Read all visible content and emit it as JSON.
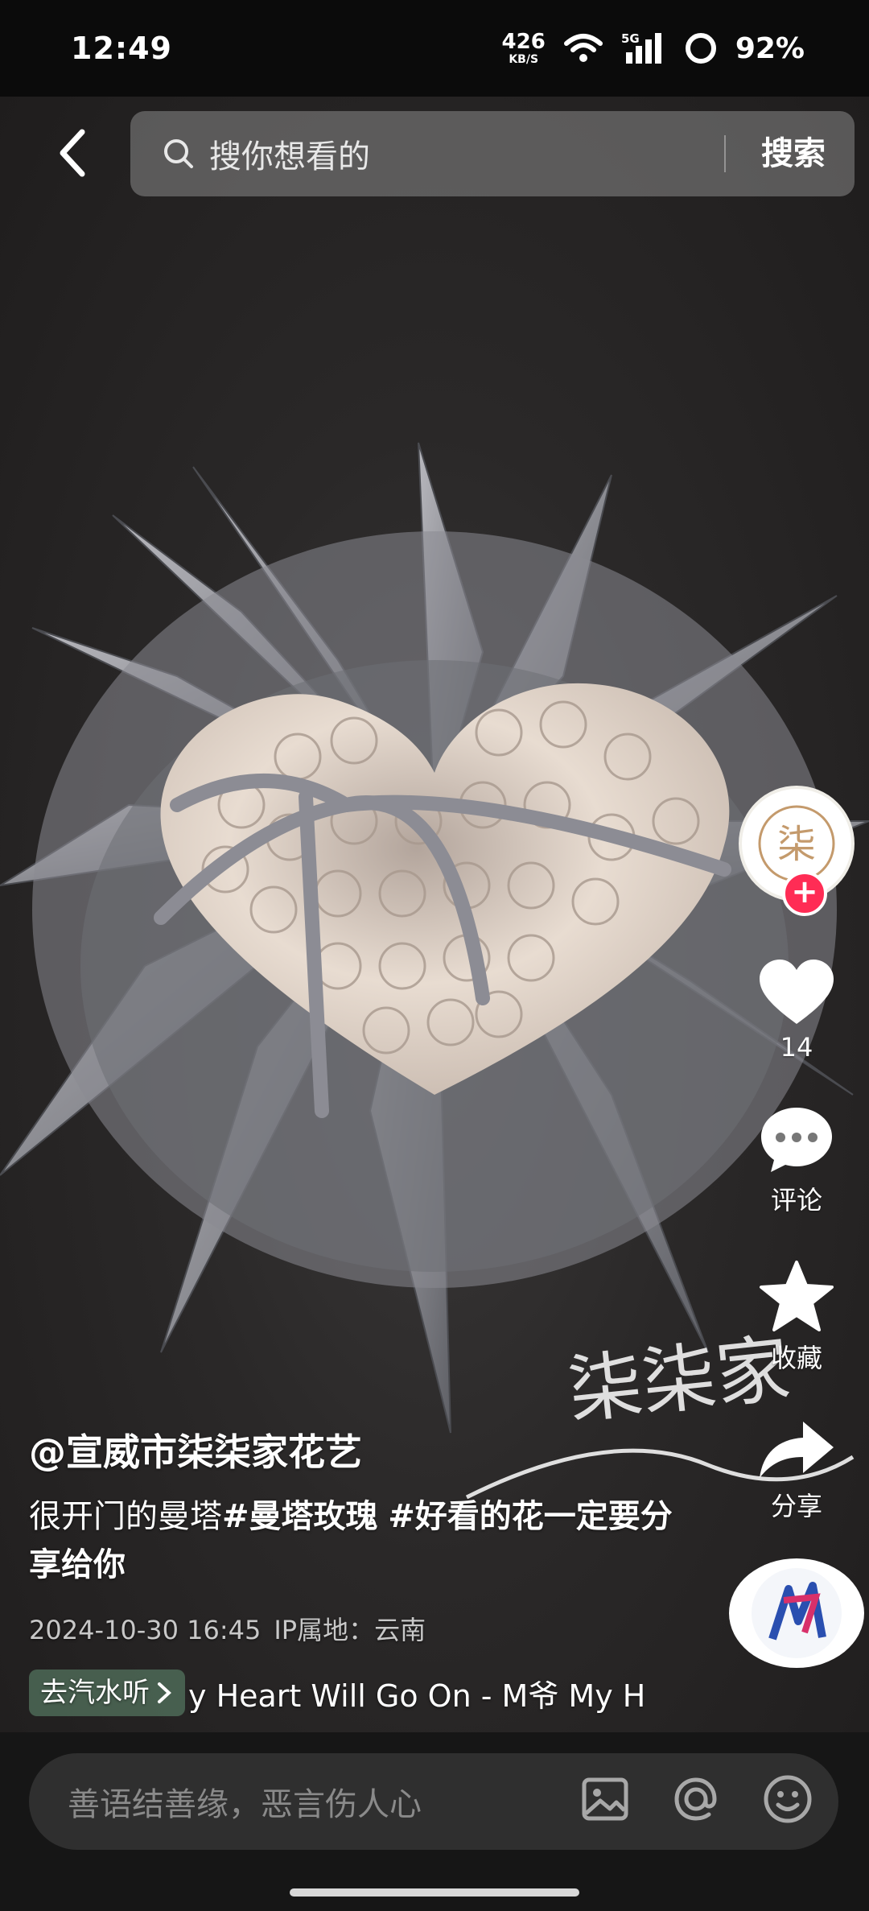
{
  "status_bar": {
    "time": "12:49",
    "net_speed_value": "426",
    "net_speed_unit": "KB/S",
    "network": "5G",
    "battery": "92%"
  },
  "search": {
    "placeholder": "搜你想看的",
    "button_label": "搜索"
  },
  "actions": {
    "like_count": "14",
    "comment_label": "评论",
    "favorite_label": "收藏",
    "share_label": "分享"
  },
  "post": {
    "author": "@宣威市柒柒家花艺",
    "desc_text": "很开门的曼塔",
    "tag1": "#曼塔玫瑰",
    "tag2": "#好看的花一定要分享给你",
    "datetime": "2024-10-30 16:45",
    "ip_location": "IP属地：云南",
    "music_chip": "去汽水听",
    "music_name": "y Heart Will Go On - M爷    My H"
  },
  "comment_bar": {
    "placeholder": "善语结善缘，恶言伤人心"
  }
}
